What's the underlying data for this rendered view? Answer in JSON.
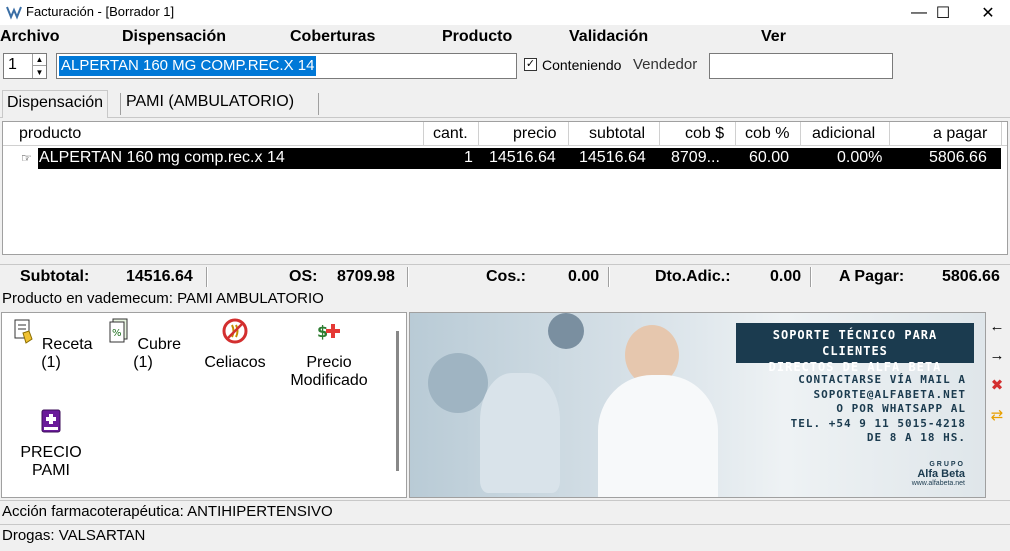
{
  "window": {
    "title": "Facturación - [Borrador 1]",
    "minimize_glyph": "—",
    "maximize_glyph": "☐",
    "close_glyph": "✕"
  },
  "menu": [
    "Archivo",
    "Dispensación",
    "Coberturas",
    "Producto",
    "Validación",
    "Ver"
  ],
  "search": {
    "quantity": "1",
    "query": "ALPERTAN 160 MG COMP.REC.X 14",
    "contains_label": "Conteniendo",
    "contains_checked": "✓",
    "vendor_label": "Vendedor",
    "vendor_value": ""
  },
  "tabs": [
    "Dispensación",
    "PAMI (AMBULATORIO)"
  ],
  "grid": {
    "columns": [
      "producto",
      "cant.",
      "precio",
      "subtotal",
      "cob $",
      "cob %",
      "adicional",
      "a pagar"
    ],
    "rows": [
      {
        "producto": "ALPERTAN 160 mg comp.rec.x 14",
        "cant": "1",
        "precio": "14516.64",
        "subtotal": "14516.64",
        "cob_amount": "8709...",
        "cob_pct": "60.00",
        "adicional": "0.00%",
        "a_pagar": "5806.66"
      }
    ]
  },
  "totals": {
    "subtotal_label": "Subtotal:",
    "subtotal": "14516.64",
    "os_label": "OS:",
    "os": "8709.98",
    "cos_label": "Cos.:",
    "cos": "0.00",
    "dto_label": "Dto.Adic.:",
    "dto": "0.00",
    "apagar_label": "A Pagar:",
    "apagar": "5806.66"
  },
  "vademecum_info": "Producto en vademecum: PAMI AMBULATORIO",
  "actions": {
    "receta": "Receta (1)",
    "cubre": "Cubre (1)",
    "celiacos": "Celiacos",
    "precio_modificado_1": "Precio",
    "precio_modificado_2": "Modificado",
    "precio_pami_1": "PRECIO",
    "precio_pami_2": "PAMI"
  },
  "banner": {
    "head_1": "SOPORTE TÉCNICO PARA CLIENTES",
    "head_2": "DIRECTOS DE ALFA BETA",
    "line_1": "CONTACTARSE VÍA MAIL A",
    "line_2": "SOPORTE@ALFABETA.NET",
    "line_3": "O POR WHATSAPP AL",
    "line_4": "TEL. +54 9 11 5015-4218",
    "line_5": "DE 8 A 18 HS.",
    "brand_1": "GRUPO",
    "brand_2": "Alfa Beta",
    "brand_3": "www.alfabeta.net"
  },
  "footer": {
    "accion": "Acción farmacoterapéutica: ANTIHIPERTENSIVO",
    "drogas": "Drogas: VALSARTAN"
  },
  "icons": [
    "app-icon",
    "spin-up-icon",
    "spin-down-icon",
    "row-pointer-icon",
    "receta-icon",
    "cubre-icon",
    "celiacos-icon",
    "precio-modificado-icon",
    "precio-pami-icon",
    "arrow-left-icon",
    "arrow-right-icon",
    "delete-icon",
    "refresh-icon"
  ]
}
